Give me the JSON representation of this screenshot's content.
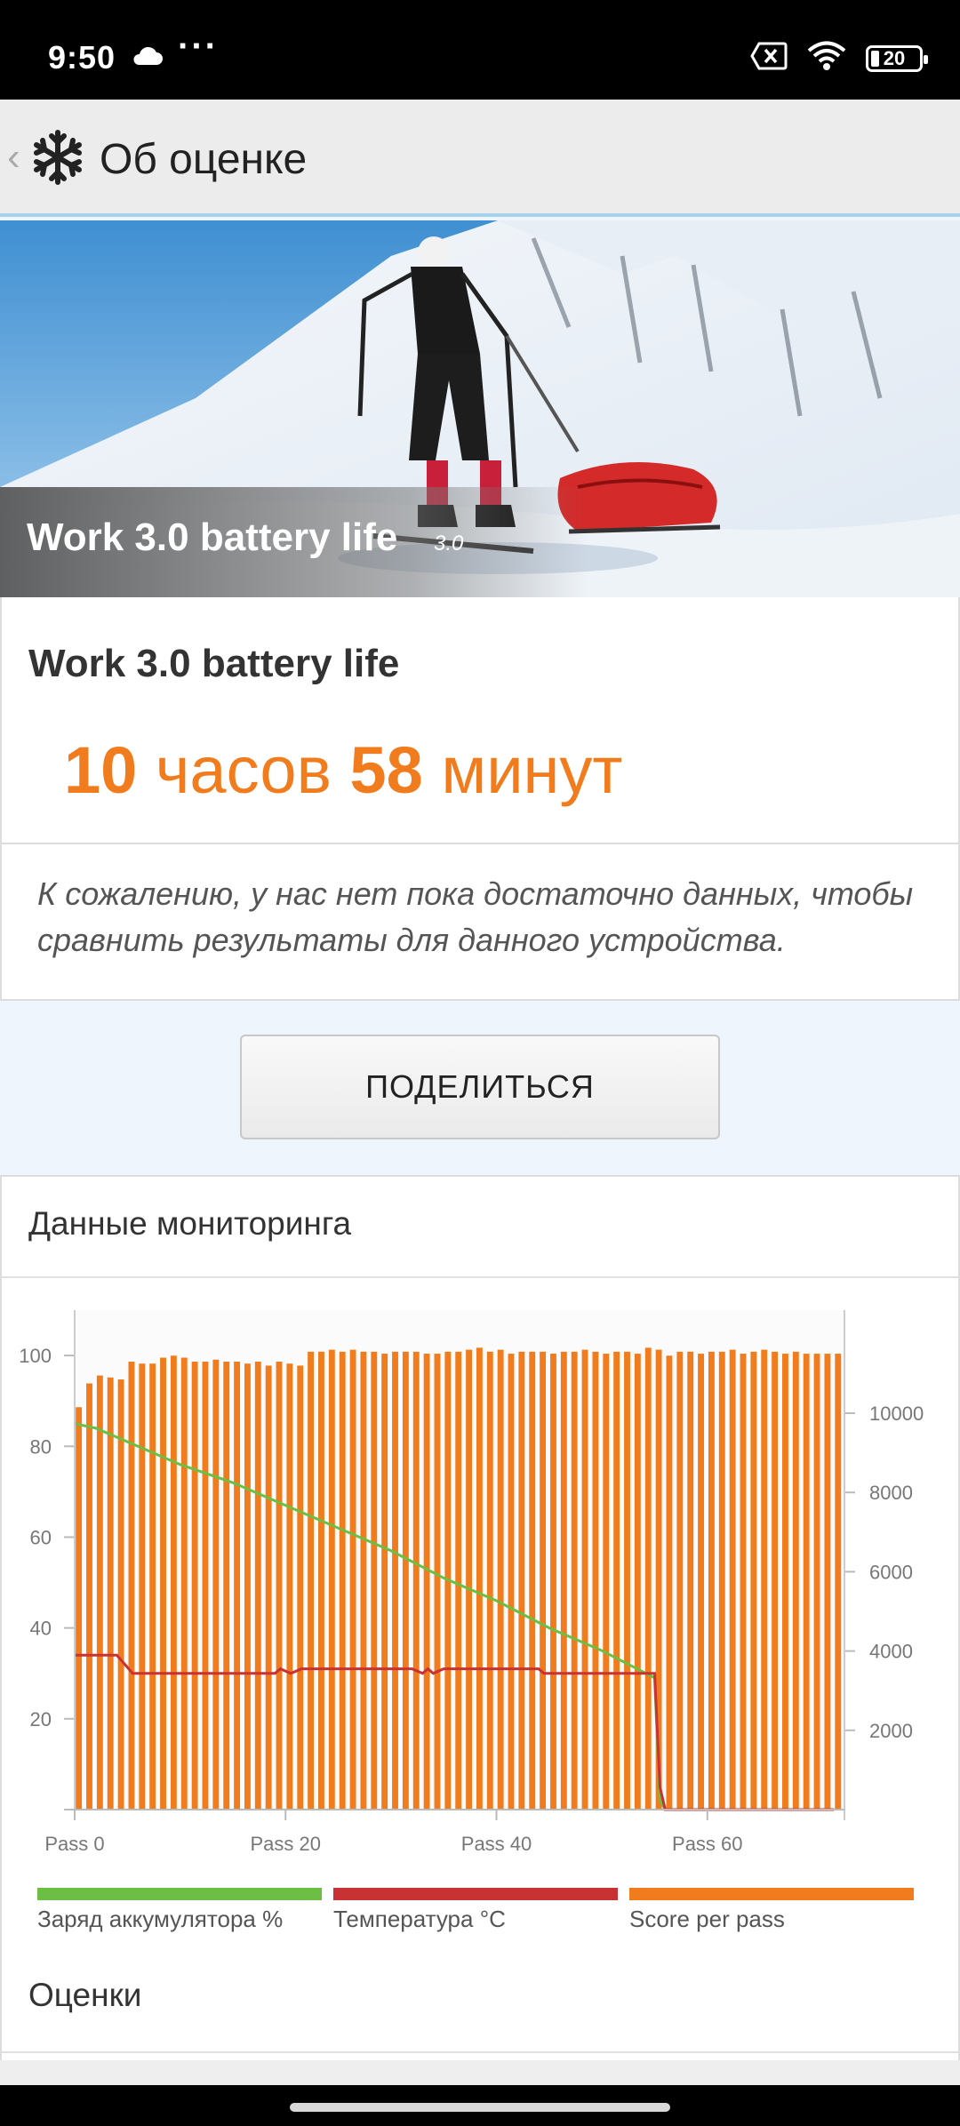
{
  "status_bar": {
    "time": "9:50",
    "battery": "20"
  },
  "app_bar": {
    "title": "Об оценке"
  },
  "hero": {
    "title": "Work 3.0 battery life",
    "version": "3.0"
  },
  "result": {
    "title": "Work 3.0 battery life",
    "hours": "10",
    "hours_unit": "часов",
    "minutes": "58",
    "minutes_unit": "минут"
  },
  "note": "К сожалению, у нас нет пока достаточно данных, чтобы сравнить результаты для данного устройства.",
  "share_label": "ПОДЕЛИТЬСЯ",
  "monitoring": {
    "title": "Данные мониторинга"
  },
  "ratings": {
    "title": "Оценки"
  },
  "colors": {
    "accent": "#f07c1e",
    "battery": "#6cbe45",
    "temperature": "#c83232",
    "score": "#f07c1e"
  },
  "chart_data": {
    "type": "bar",
    "x_tick_labels": [
      "Pass 0",
      "Pass 20",
      "Pass 40",
      "Pass 60"
    ],
    "x_ticks": [
      0,
      20,
      40,
      60
    ],
    "xlim": [
      0,
      73
    ],
    "left_axis": {
      "ylim": [
        0,
        110
      ],
      "ticks": [
        20,
        40,
        60,
        80,
        100
      ]
    },
    "right_axis": {
      "ylim": [
        0,
        12600
      ],
      "ticks": [
        2000,
        4000,
        6000,
        8000,
        10000
      ]
    },
    "series": [
      {
        "name": "Score per pass",
        "type": "bar",
        "axis": "right",
        "values": [
          10150,
          10750,
          10950,
          10900,
          10850,
          11300,
          11250,
          11250,
          11400,
          11450,
          11400,
          11300,
          11300,
          11350,
          11300,
          11300,
          11250,
          11300,
          11200,
          11300,
          11250,
          11200,
          11550,
          11550,
          11600,
          11550,
          11600,
          11550,
          11550,
          11500,
          11550,
          11550,
          11550,
          11500,
          11500,
          11550,
          11550,
          11600,
          11650,
          11550,
          11600,
          11500,
          11550,
          11550,
          11550,
          11500,
          11550,
          11550,
          11600,
          11550,
          11500,
          11550,
          11550,
          11500,
          11650,
          11600,
          11450,
          11550,
          11550,
          11500,
          11550,
          11550,
          11600,
          11500,
          11550,
          11600,
          11550,
          11500,
          11550,
          11500,
          11500,
          11500,
          11500
        ]
      },
      {
        "name": "Заряд аккумулятора %",
        "type": "line",
        "axis": "left",
        "x": [
          0,
          2,
          5,
          10,
          15,
          20,
          25,
          30,
          35,
          40,
          45,
          50,
          55,
          55.5,
          56,
          72
        ],
        "values": [
          85,
          84,
          81,
          76,
          72,
          67,
          62,
          57,
          51,
          46,
          40,
          35,
          29,
          2,
          0,
          0
        ]
      },
      {
        "name": "Температура °C",
        "type": "line",
        "axis": "left",
        "x": [
          0,
          4,
          5.5,
          19,
          19.5,
          20.5,
          21.5,
          22,
          32,
          33,
          33.5,
          34,
          35,
          44,
          44.5,
          55,
          55.5,
          56,
          72
        ],
        "values": [
          34,
          34,
          30,
          30,
          31,
          30,
          31,
          31,
          31,
          30,
          31,
          30,
          31,
          31,
          30,
          30,
          5,
          0,
          0
        ]
      }
    ],
    "legend": [
      "Заряд аккумулятора %",
      "Температура °C",
      "Score per pass"
    ],
    "legend_position": "bottom"
  }
}
